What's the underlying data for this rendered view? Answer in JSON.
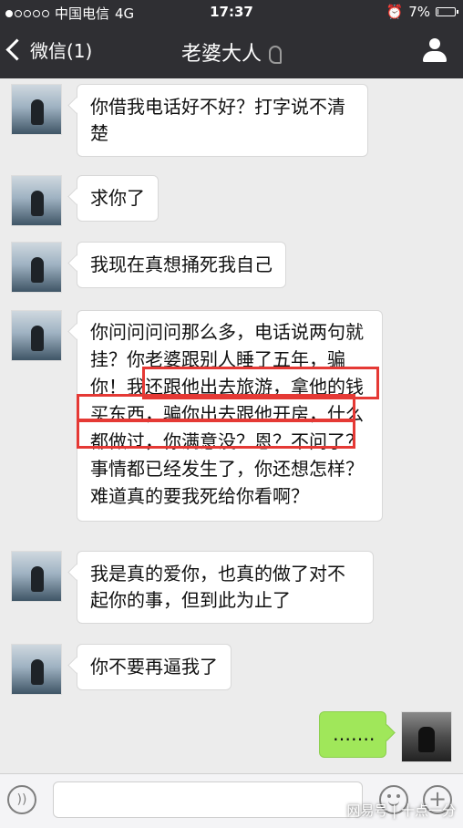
{
  "status_bar": {
    "carrier": "中国电信",
    "network": "4G",
    "time": "17:37",
    "battery": "7%",
    "battery_level": 0.07
  },
  "nav": {
    "back_label": "微信(1)",
    "title": "老婆大人",
    "profile_icon": "person-icon",
    "ear_icon": "ear-icon"
  },
  "messages": [
    {
      "text": "你借我电话好不好？打字说不清楚"
    },
    {
      "text": "求你了"
    },
    {
      "text": "我现在真想捅死我自己"
    },
    {
      "text": "你问问问问那么多，电话说两句就挂？你老婆跟别人睡了五年，骗你！我还跟他出去旅游，拿他的钱买东西，骗你出去跟他开房，什么都做过，你满意没？恩？不问了？事情都已经发生了，你还想怎样？难道真的要我死给你看啊？"
    },
    {
      "text": "我是真的爱你，也真的做了对不起你的事，但到此为止了"
    },
    {
      "text": "你不要再逼我了"
    }
  ],
  "self_message": {
    "text": "……."
  },
  "input_bar": {
    "voice_icon": "voice-icon",
    "emoji_icon": "emoji-icon",
    "plus_icon": "plus-icon"
  },
  "watermark": "网易号 | 十点一分",
  "colors": {
    "header_bg": "#2f2f33",
    "chat_bg": "#ececec",
    "self_bubble": "#a0e75a",
    "highlight_box": "#e53935"
  }
}
